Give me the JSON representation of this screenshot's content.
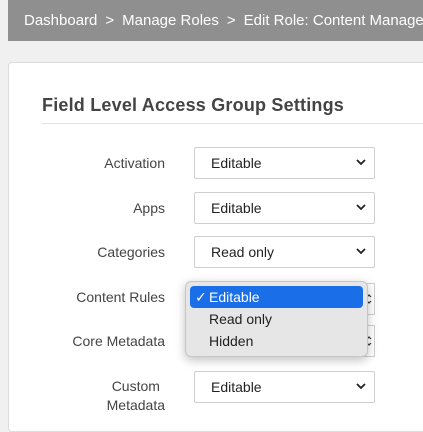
{
  "breadcrumb": {
    "icon": "home-icon",
    "items": [
      "Dashboard",
      "Manage Roles",
      "Edit Role: Content Manager"
    ],
    "separator": ">"
  },
  "section": {
    "title": "Field Level Access Group Settings"
  },
  "rows": [
    {
      "label": "Activation",
      "value": "Editable"
    },
    {
      "label": "Apps",
      "value": "Editable"
    },
    {
      "label": "Categories",
      "value": "Read only"
    },
    {
      "label": "Content Rules",
      "value": "Editable"
    },
    {
      "label": "Core Metadata",
      "value": ""
    },
    {
      "label_line1": "Custom",
      "label_line2": "Metadata",
      "value": "Editable"
    }
  ],
  "dropdown": {
    "check": "✓",
    "options": [
      "Editable",
      "Read only",
      "Hidden"
    ],
    "selected": "Editable"
  },
  "colors": {
    "breadcrumb_bg": "#8f8f8f",
    "selected_option": "#1a6ee8"
  }
}
